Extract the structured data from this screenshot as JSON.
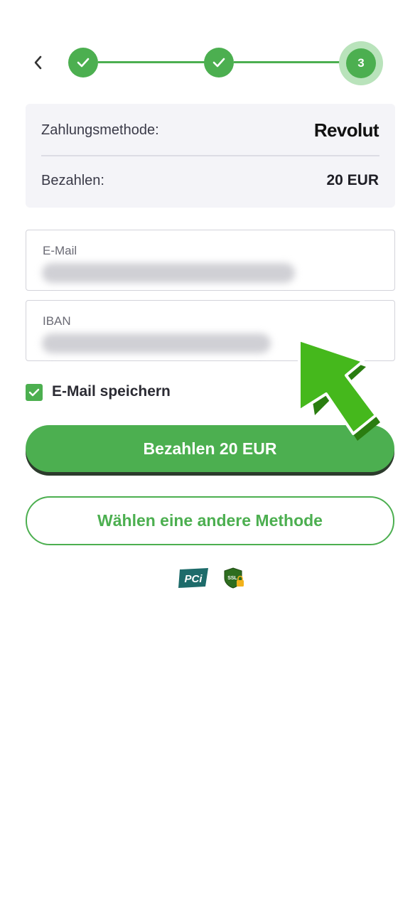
{
  "stepper": {
    "steps": [
      {
        "state": "done",
        "icon": "check-icon"
      },
      {
        "state": "done",
        "icon": "check-icon"
      },
      {
        "state": "current",
        "label": "3"
      }
    ],
    "accent": "#4caf50"
  },
  "summary": {
    "payment_method_label": "Zahlungsmethode:",
    "provider_logo_text": "Revolut",
    "pay_label": "Bezahlen:",
    "amount": "20 EUR"
  },
  "form": {
    "email_label": "E-Mail",
    "iban_label": "IBAN"
  },
  "save_email": {
    "label": "E-Mail speichern",
    "checked": true
  },
  "buttons": {
    "pay": "Bezahlen 20 EUR",
    "other_method": "Wählen eine andere Methode"
  },
  "badges": {
    "pci": "PCi",
    "ssl": "SSL"
  },
  "colors": {
    "accent": "#4caf50",
    "arrow": "#3fb11d"
  }
}
